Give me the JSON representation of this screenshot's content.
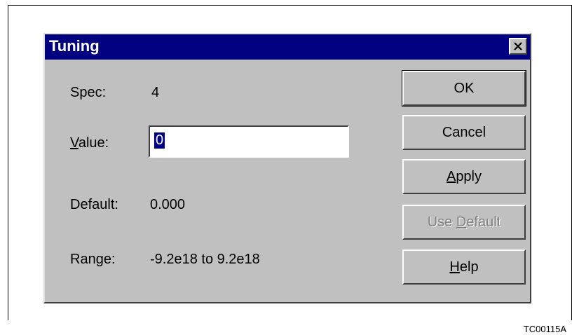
{
  "dialog": {
    "title": "Tuning",
    "close_symbol": "×"
  },
  "fields": {
    "spec_label": "Spec:",
    "spec_value": "4",
    "value_label_mnemonic": "V",
    "value_label_rest": "alue:",
    "value_input": "0",
    "default_label": "Default:",
    "default_value": "0.000",
    "range_label": "Range:",
    "range_value": "-9.2e18 to 9.2e18"
  },
  "buttons": {
    "ok": "OK",
    "cancel": "Cancel",
    "apply_mnemonic": "A",
    "apply_rest": "pply",
    "use_default_prefix": "Use ",
    "use_default_mnemonic": "D",
    "use_default_rest": "efault",
    "help_mnemonic": "H",
    "help_rest": "elp"
  },
  "figure_id": "TC00115A",
  "colors": {
    "titlebar": "#000080",
    "dialog_face": "#c0c0c0",
    "disabled_text": "#808080"
  }
}
